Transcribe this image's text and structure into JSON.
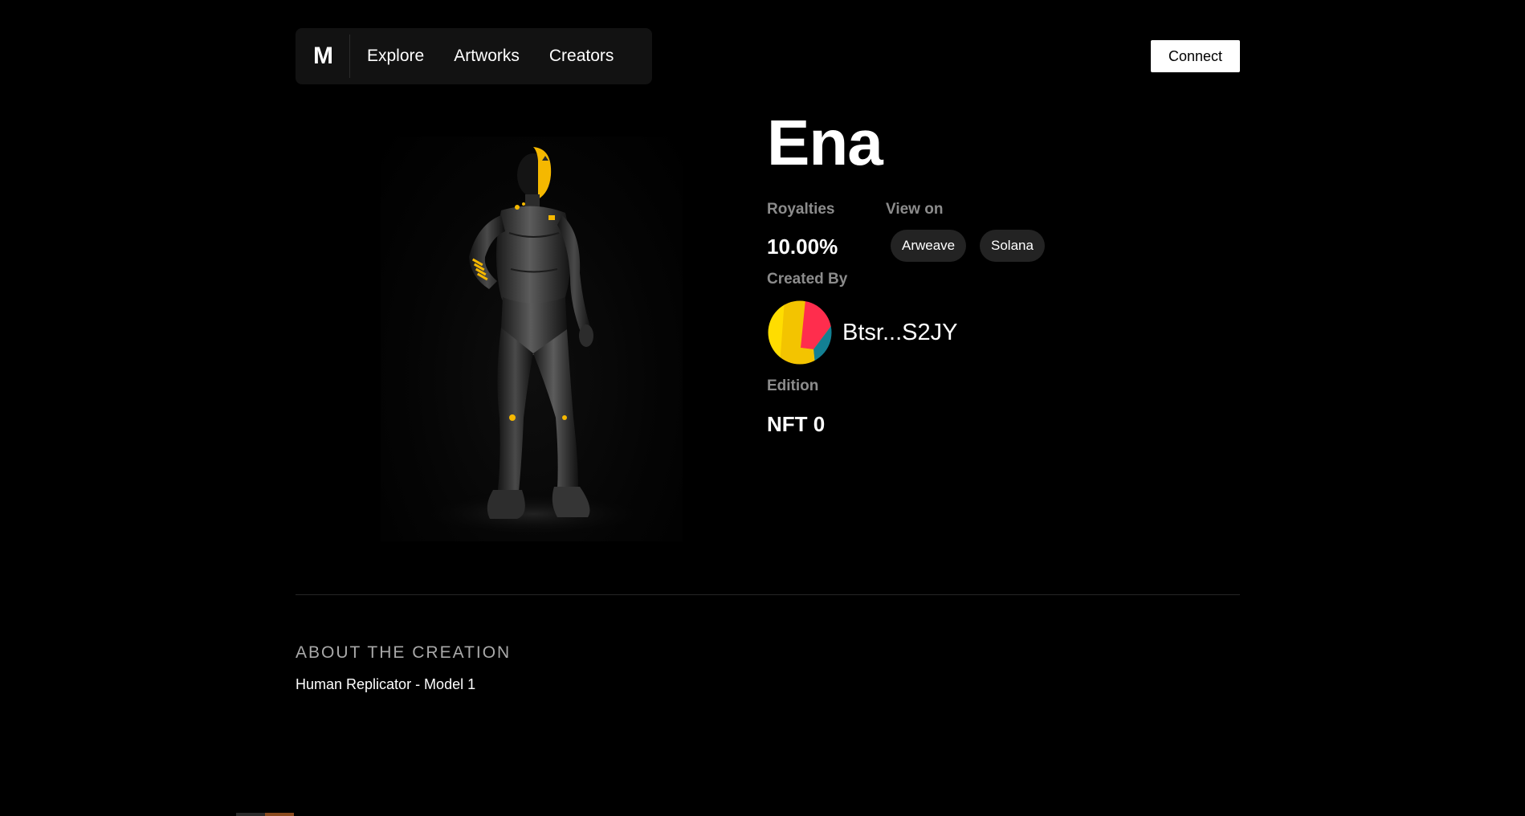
{
  "nav": {
    "logo": "M",
    "links": [
      "Explore",
      "Artworks",
      "Creators"
    ],
    "connect_label": "Connect"
  },
  "artwork": {
    "title": "Ena",
    "royalties_label": "Royalties",
    "royalties_value": "10.00%",
    "view_on_label": "View on",
    "view_on_links": [
      "Arweave",
      "Solana"
    ],
    "created_by_label": "Created By",
    "creator_name": "Btsr...S2JY",
    "edition_label": "Edition",
    "edition_value": "NFT 0"
  },
  "about": {
    "heading": "ABOUT THE CREATION",
    "text": "Human Replicator - Model 1"
  },
  "colors": {
    "background": "#000000",
    "nav_bg": "#121212",
    "chip_bg": "#232323",
    "label_gray": "#8c8c8c",
    "helmet_yellow": "#f5b800",
    "avatar_yellow": "#f3c400",
    "avatar_red": "#ff2d4d",
    "avatar_teal": "#138093"
  }
}
